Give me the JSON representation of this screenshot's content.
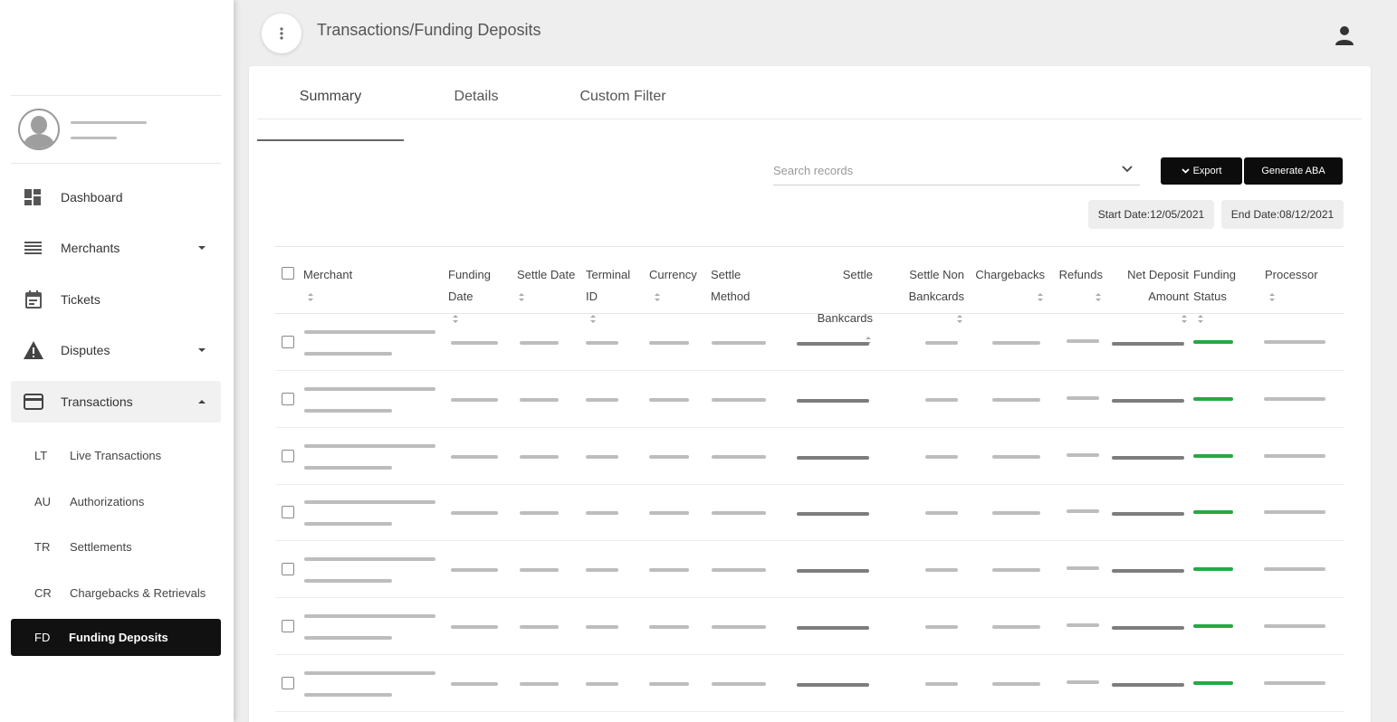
{
  "header": {
    "title": "Transactions/Funding Deposits"
  },
  "sidebar": {
    "items": [
      {
        "label": "Dashboard",
        "icon": "dashboard-icon",
        "expandable": false
      },
      {
        "label": "Merchants",
        "icon": "list-icon",
        "expandable": true,
        "expanded": false
      },
      {
        "label": "Tickets",
        "icon": "calendar-icon",
        "expandable": false
      },
      {
        "label": "Disputes",
        "icon": "warning-icon",
        "expandable": true,
        "expanded": false
      },
      {
        "label": "Transactions",
        "icon": "credit-card-icon",
        "expandable": true,
        "expanded": true
      }
    ],
    "subitems": [
      {
        "abbr": "LT",
        "label": "Live Transactions"
      },
      {
        "abbr": "AU",
        "label": "Authorizations"
      },
      {
        "abbr": "TR",
        "label": "Settlements"
      },
      {
        "abbr": "CR",
        "label": "Chargebacks & Retrievals"
      },
      {
        "abbr": "FD",
        "label": "Funding Deposits",
        "selected": true
      }
    ]
  },
  "tabs": [
    {
      "label": "Summary",
      "active": true
    },
    {
      "label": "Details"
    },
    {
      "label": "Custom Filter"
    }
  ],
  "toolbar": {
    "search_placeholder": "Search records",
    "export_label": "Export",
    "generate_label": "Generate ABA",
    "start_date": "Start Date:12/05/2021",
    "end_date": "End Date:08/12/2021"
  },
  "table": {
    "columns": [
      {
        "line1": "Merchant",
        "line2": ""
      },
      {
        "line1": "Funding",
        "line2": "Date"
      },
      {
        "line1": "Settle Date",
        "line2": ""
      },
      {
        "line1": "Terminal",
        "line2": "ID"
      },
      {
        "line1": "Currency",
        "line2": ""
      },
      {
        "line1": "Settle",
        "line2": "Method"
      },
      {
        "line1": "Settle",
        "line2": "Bankcards"
      },
      {
        "line1": "Settle Non",
        "line2": "Bankcards"
      },
      {
        "line1": "Chargebacks",
        "line2": ""
      },
      {
        "line1": "Refunds",
        "line2": ""
      },
      {
        "line1": "Net Deposit",
        "line2": "Amount"
      },
      {
        "line1": "Funding",
        "line2": "Status"
      },
      {
        "line1": "Processor",
        "line2": ""
      }
    ],
    "row_count": 7
  },
  "colors": {
    "accent_dark": "#0c0c0c",
    "status_green": "#27a844",
    "placeholder_gray": "#bdbdbd"
  }
}
